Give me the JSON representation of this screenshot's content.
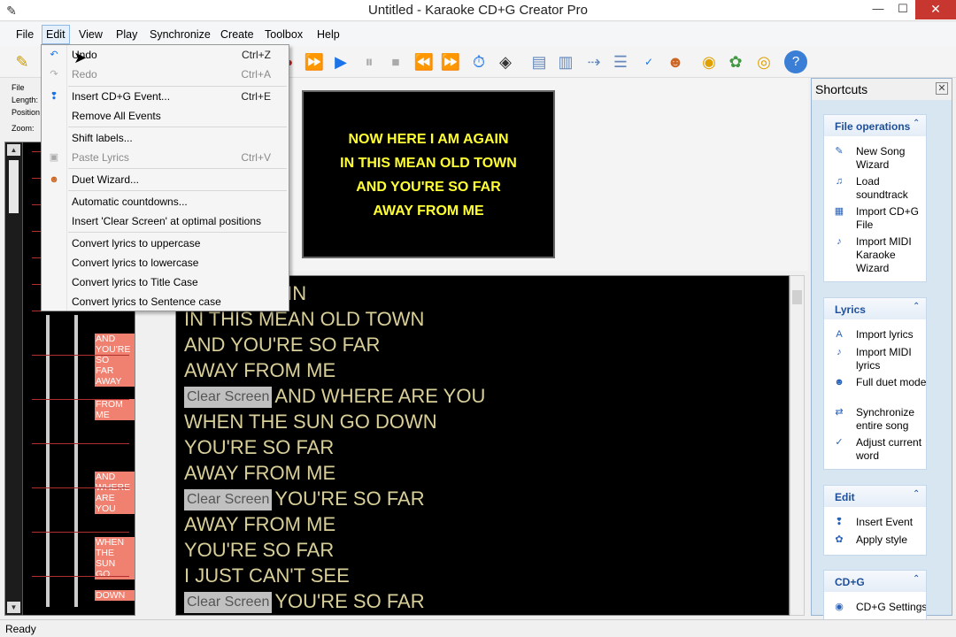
{
  "window": {
    "title": "Untitled - Karaoke CD+G Creator Pro",
    "minimize": "—",
    "maximize": "☐",
    "close": "✕"
  },
  "menubar": [
    "File",
    "Edit",
    "View",
    "Play",
    "Synchronize",
    "Create",
    "Toolbox",
    "Help"
  ],
  "edit_menu": {
    "undo": {
      "label": "Undo",
      "shortcut": "Ctrl+Z"
    },
    "redo": {
      "label": "Redo",
      "shortcut": "Ctrl+A"
    },
    "insert_event": {
      "label": "Insert CD+G Event...",
      "shortcut": "Ctrl+E"
    },
    "remove_all": {
      "label": "Remove All Events"
    },
    "shift_labels": {
      "label": "Shift labels..."
    },
    "paste_lyrics": {
      "label": "Paste Lyrics",
      "shortcut": "Ctrl+V"
    },
    "duet_wizard": {
      "label": "Duet Wizard..."
    },
    "auto_countdowns": {
      "label": "Automatic countdowns..."
    },
    "insert_clear": {
      "label": "Insert 'Clear Screen' at optimal positions"
    },
    "to_upper": {
      "label": "Convert lyrics to uppercase"
    },
    "to_lower": {
      "label": "Convert lyrics to lowercase"
    },
    "to_title": {
      "label": "Convert lyrics to Title Case"
    },
    "to_sentence": {
      "label": "Convert lyrics to Sentence case"
    }
  },
  "info_panel": {
    "file": "File",
    "length": "Length:",
    "position": "Position",
    "zoom": "Zoom:"
  },
  "timeline_words": [
    "AND",
    "YOU'RE",
    "SO",
    "FAR",
    "AWAY",
    "FROM",
    "ME",
    "AND",
    "WHERE",
    "ARE",
    "YOU",
    "WHEN",
    "THE",
    "SUN",
    "GO",
    "DOWN"
  ],
  "preview": {
    "lines": [
      "NOW HERE I AM AGAIN",
      "IN THIS MEAN OLD TOWN",
      "AND YOU'RE SO FAR",
      "AWAY FROM ME"
    ]
  },
  "lyrics": {
    "clear_screen_label": "Clear Screen",
    "lines": [
      {
        "text": "E I AM AGAIN"
      },
      {
        "text": "IN THIS MEAN OLD TOWN"
      },
      {
        "text": "AND YOU'RE SO FAR"
      },
      {
        "text": "AWAY FROM ME"
      },
      {
        "text": "AND WHERE ARE YOU"
      },
      {
        "text": "WHEN THE SUN GO DOWN"
      },
      {
        "text": "YOU'RE SO FAR"
      },
      {
        "text": "AWAY FROM ME"
      },
      {
        "text": "YOU'RE SO FAR"
      },
      {
        "text": "AWAY FROM ME"
      },
      {
        "text": "YOU'RE SO FAR"
      },
      {
        "text": "I JUST CAN'T SEE"
      },
      {
        "text": "YOU'RE SO FAR"
      }
    ]
  },
  "shortcuts": {
    "title": "Shortcuts",
    "groups": [
      {
        "title": "File operations",
        "items": [
          "New Song Wizard",
          "Load soundtrack",
          "Import CD+G File",
          "Import MIDI Karaoke Wizard"
        ]
      },
      {
        "title": "Lyrics",
        "items": [
          "Import lyrics",
          "Import MIDI lyrics",
          "Full duet mode",
          "Synchronize entire song",
          "Adjust current word"
        ]
      },
      {
        "title": "Edit",
        "items": [
          "Insert Event",
          "Apply style"
        ]
      },
      {
        "title": "CD+G",
        "items": [
          "CD+G Settings"
        ]
      }
    ]
  },
  "status": {
    "text": "Ready"
  }
}
